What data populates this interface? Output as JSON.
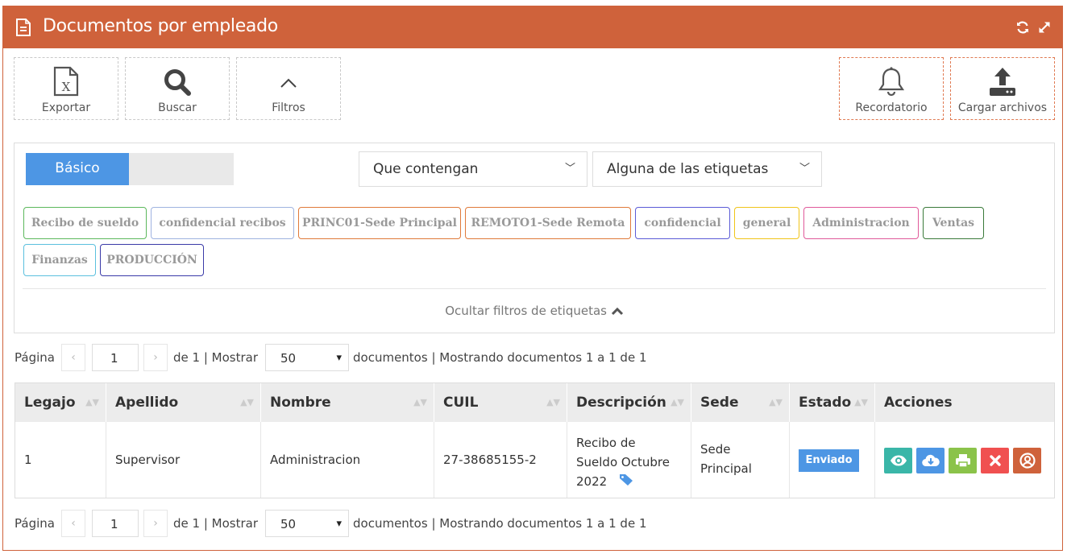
{
  "header": {
    "title": "Documentos por empleado",
    "color": "#cf623b"
  },
  "toolbar": {
    "export_label": "Exportar",
    "search_label": "Buscar",
    "filters_label": "Filtros",
    "reminder_label": "Recordatorio",
    "upload_label": "Cargar archivos"
  },
  "filters": {
    "mode_basic": "Básico",
    "match_select": "Que contengan",
    "tags_select": "Alguna de las etiquetas",
    "tags": [
      {
        "label": "Recibo de sueldo",
        "color": "#5cb85c"
      },
      {
        "label": "confidencial recibos",
        "color": "#9fb3e0"
      },
      {
        "label": "PRINC01-Sede Principal",
        "color": "#e07a3a"
      },
      {
        "label": "REMOTO1-Sede Remota",
        "color": "#e07a3a"
      },
      {
        "label": "confidencial",
        "color": "#5b5bd6"
      },
      {
        "label": "general",
        "color": "#f0c419"
      },
      {
        "label": "Administracion",
        "color": "#e05a9a"
      },
      {
        "label": "Ventas",
        "color": "#3a7a3a"
      },
      {
        "label": "Finanzas",
        "color": "#5bc0de"
      },
      {
        "label": "PRODUCCIÓN",
        "color": "#3a3aa8"
      }
    ],
    "hide_tags_label": "Ocultar filtros de etiquetas"
  },
  "pager": {
    "page_label": "Página",
    "prev": "‹",
    "next": "›",
    "page_value": "1",
    "of_show": "de 1 | Mostrar",
    "per_page": "50",
    "summary": "documentos | Mostrando documentos 1 a 1 de 1"
  },
  "table": {
    "columns": [
      "Legajo",
      "Apellido",
      "Nombre",
      "CUIL",
      "Descripción",
      "Sede",
      "Estado",
      "Acciones"
    ],
    "rows": [
      {
        "legajo": "1",
        "apellido": "Supervisor",
        "nombre": "Administracion",
        "cuil": "27-38685155-2",
        "descripcion": [
          "Recibo de",
          "Sueldo Octubre",
          "2022"
        ],
        "sede": [
          "Sede",
          "Principal"
        ],
        "estado": "Enviado"
      }
    ]
  },
  "actions": [
    {
      "name": "view",
      "icon": "eye-icon",
      "color": "#3ab6a8"
    },
    {
      "name": "download",
      "icon": "cloud-download-icon",
      "color": "#4d96e4"
    },
    {
      "name": "print",
      "icon": "print-icon",
      "color": "#8bc34a"
    },
    {
      "name": "delete",
      "icon": "close-icon",
      "color": "#f05050"
    },
    {
      "name": "user",
      "icon": "user-circle-icon",
      "color": "#cf623b"
    }
  ],
  "colors": {
    "accent": "#cf623b",
    "primary": "#4d96e4"
  }
}
